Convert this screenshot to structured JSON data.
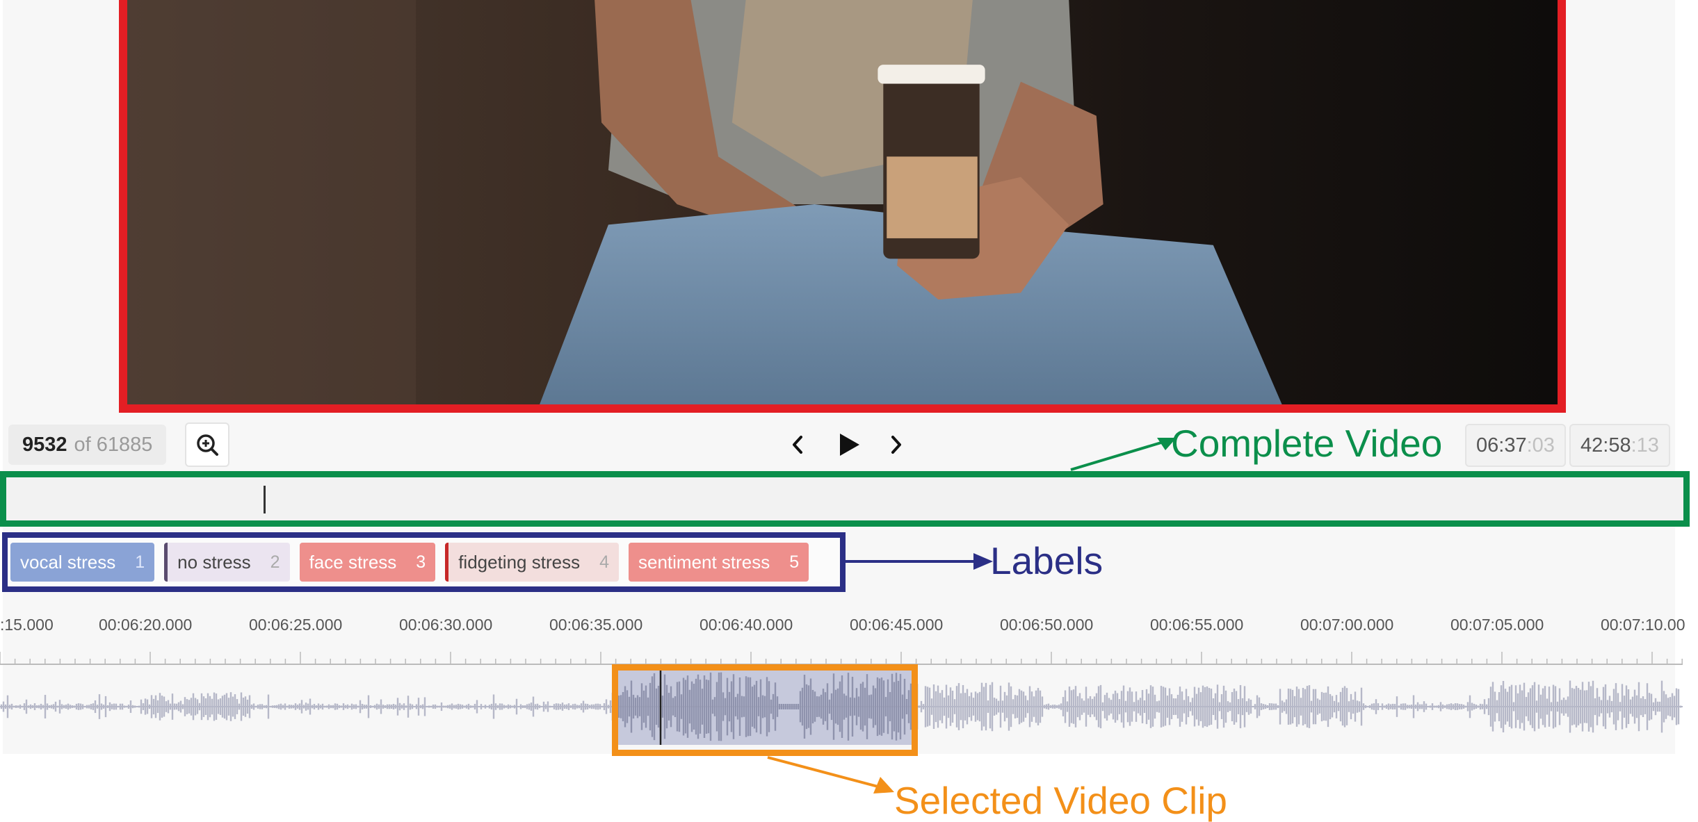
{
  "toolbar": {
    "frame_current": "9532",
    "frame_of": "of 61885",
    "current_time_main": "06:37",
    "current_time_frac": ":03",
    "total_time_main": "42:58",
    "total_time_frac": ":13"
  },
  "labels": [
    {
      "name": "vocal stress",
      "key": "1",
      "bg": "#8aa3d6",
      "fg": "#ffffff",
      "keyfg": "#dfe7fb",
      "bar": ""
    },
    {
      "name": "no stress",
      "key": "2",
      "bg": "#ebe4f0",
      "fg": "#444444",
      "keyfg": "#aaaaaa",
      "bar": "#5a4b6e"
    },
    {
      "name": "face stress",
      "key": "3",
      "bg": "#ee8f8c",
      "fg": "#ffffff",
      "keyfg": "#ffffff",
      "bar": ""
    },
    {
      "name": "fidgeting stress",
      "key": "4",
      "bg": "#f3dedd",
      "fg": "#444444",
      "keyfg": "#aaaaaa",
      "bar": "#c62828"
    },
    {
      "name": "sentiment stress",
      "key": "5",
      "bg": "#ee8f8c",
      "fg": "#ffffff",
      "keyfg": "#ffffff",
      "bar": ""
    }
  ],
  "timeline": {
    "tick_labels": [
      ":15.000",
      "00:06:20.000",
      "00:06:25.000",
      "00:06:30.000",
      "00:06:35.000",
      "00:06:40.000",
      "00:06:45.000",
      "00:06:50.000",
      "00:06:55.000",
      "00:07:00.000",
      "00:07:05.000",
      "00:07:10.00"
    ]
  },
  "annotations": {
    "complete_video": "Complete Video",
    "labels": "Labels",
    "selected_clip": "Selected Video Clip"
  },
  "colors": {
    "video_border": "#e31e24",
    "complete_video": "#0b8f4b",
    "labels": "#2b2f86",
    "selected_clip": "#f39019",
    "waveform": "#b6b8c8",
    "selection_fill": "#c6c9dc"
  },
  "icons": {
    "zoom": "zoom-in-icon",
    "prev": "chevron-left-icon",
    "play": "play-icon",
    "next": "chevron-right-icon"
  }
}
